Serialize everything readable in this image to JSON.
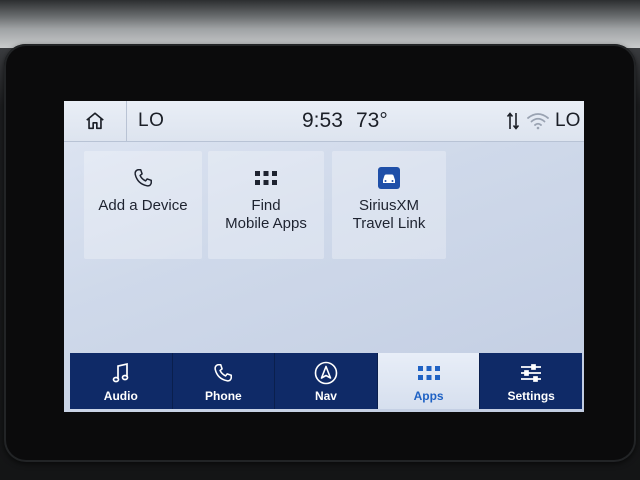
{
  "status_bar": {
    "left_temp": "LO",
    "clock": "9:53",
    "outside_temp": "73°",
    "right_temp": "LO",
    "icons": [
      "home-icon",
      "data-arrows-icon",
      "wifi-icon"
    ]
  },
  "tiles": [
    {
      "label": "Add a Device",
      "icon": "phone-icon"
    },
    {
      "label_line1": "Find",
      "label_line2": "Mobile Apps",
      "icon": "apps-grid-icon"
    },
    {
      "label_line1": "SiriusXM",
      "label_line2": "Travel Link",
      "icon": "car-icon"
    }
  ],
  "nav": [
    {
      "label": "Audio",
      "icon": "music-note-icon",
      "active": false
    },
    {
      "label": "Phone",
      "icon": "phone-icon",
      "active": false
    },
    {
      "label": "Nav",
      "icon": "navigation-arrow-icon",
      "active": false
    },
    {
      "label": "Apps",
      "icon": "apps-grid-icon",
      "active": true
    },
    {
      "label": "Settings",
      "icon": "sliders-icon",
      "active": false
    }
  ],
  "colors": {
    "nav_bar": "#0f2a67",
    "active_tab_text": "#1f62c4",
    "screen_bg": "#cfd9ea"
  }
}
